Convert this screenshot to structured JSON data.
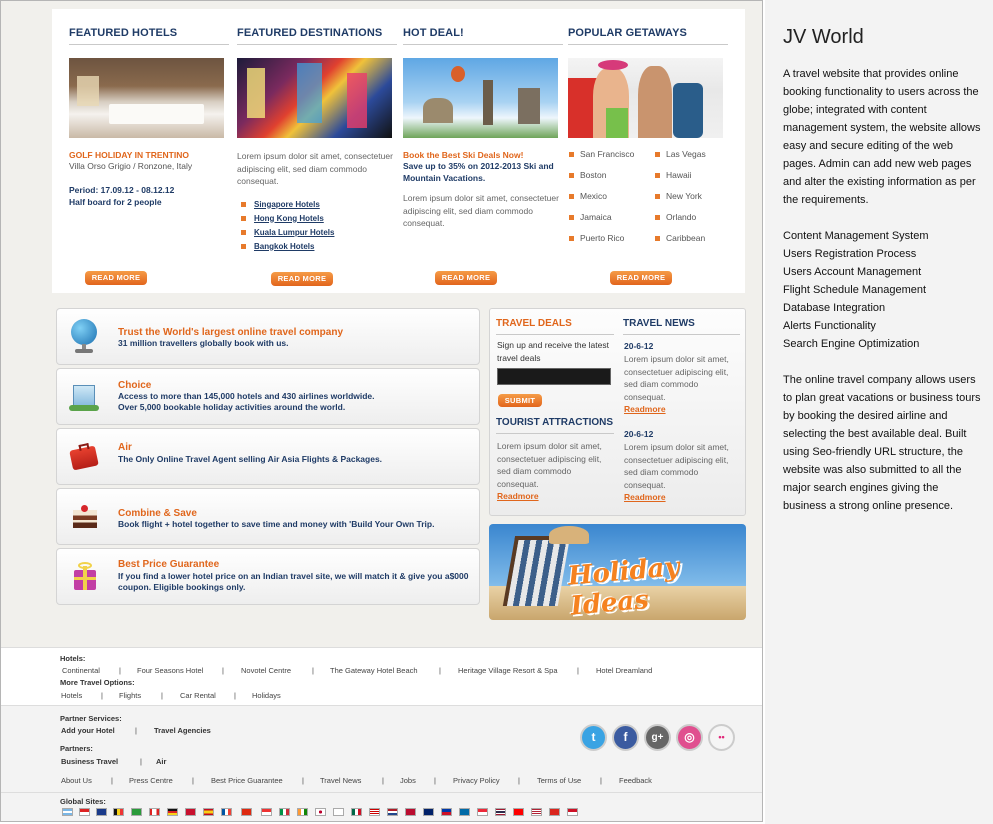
{
  "featured_hotels": {
    "heading": "FEATURED HOTELS",
    "tag": "GOLF HOLIDAY IN TRENTINO",
    "location": "Villa Orso Grigio / Ronzone, Italy",
    "period": "Period: 17.09.12 - 08.12.12",
    "board": "Half board for 2 people",
    "read_more": "READ MORE"
  },
  "featured_destinations": {
    "heading": "FEATURED DESTINATIONS",
    "text": "Lorem ipsum dolor sit amet, consectetuer adipiscing elit, sed diam commodo consequat.",
    "links": [
      "Singapore Hotels",
      "Hong Kong Hotels",
      "Kuala Lumpur Hotels",
      "Bangkok Hotels"
    ],
    "read_more": "READ MORE"
  },
  "hot_deal": {
    "heading": "HOT DEAL!",
    "tag": "Book the Best Ski Deals Now!",
    "offer": "Save up to 35% on 2012-2013 Ski and Mountain Vacations.",
    "text": "Lorem ipsum dolor sit amet, consectetuer adipiscing elit, sed diam commodo consequat.",
    "read_more": "READ MORE"
  },
  "popular_getaways": {
    "heading": "POPULAR GETAWAYS",
    "left": [
      "San Francisco",
      "Boston",
      "Mexico",
      "Jamaica",
      "Puerto Rico"
    ],
    "right": [
      "Las Vegas",
      "Hawaii",
      "New York",
      "Orlando",
      "Caribbean"
    ],
    "read_more": "READ MORE"
  },
  "features": [
    {
      "title": "Trust the World's largest online travel company",
      "desc": "31 million travellers globally book with us.",
      "icon": "globe-icon"
    },
    {
      "title": "Choice",
      "desc": "Access to more than 145,000 hotels and 430 airlines worldwide.\nOver 5,000 bookable holiday activities around the world.",
      "icon": "hotel-icon"
    },
    {
      "title": "Air",
      "desc": "The Only Online Travel Agent selling Air Asia Flights & Packages.",
      "icon": "suitcase-icon"
    },
    {
      "title": "Combine & Save",
      "desc": "Book flight + hotel together to save time and money with 'Build Your Own Trip.",
      "icon": "cake-icon"
    },
    {
      "title": "Best Price Guarantee",
      "desc": "If you find a lower hotel price on an Indian travel site, we will match it & give you a$000\ncoupon. Eligible bookings only.",
      "icon": "gift-icon"
    }
  ],
  "travel_deals": {
    "heading": "TRAVEL DEALS",
    "text": "Sign up and receive the latest travel deals",
    "submit": "SUBMIT"
  },
  "tourist": {
    "heading": "TOURIST ATTRACTIONS",
    "text": "Lorem ipsum dolor sit amet, consectetuer adipiscing elit, sed diam commodo consequat.",
    "link": "Readmore"
  },
  "travel_news": {
    "heading": "TRAVEL NEWS",
    "items": [
      {
        "date": "20-6-12",
        "text": "Lorem ipsum dolor sit amet, consectetuer adipiscing elit, sed diam commodo consequat.",
        "link": "Readmore"
      },
      {
        "date": "20-6-12",
        "text": "Lorem ipsum dolor sit amet, consectetuer adipiscing elit, sed diam commodo consequat.",
        "link": "Readmore"
      }
    ]
  },
  "holiday_banner": "Holiday Ideas",
  "footer": {
    "hotels_label": "Hotels:",
    "hotels": [
      "Continental",
      "Four Seasons Hotel",
      "Novotel  Centre",
      "The Gateway Hotel Beach",
      "Heritage Village Resort & Spa",
      "Hotel Dreamland"
    ],
    "more_label": "More Travel Options:",
    "more": [
      "Hotels",
      "Flights",
      "Car Rental",
      "Holidays"
    ],
    "partner_services_label": "Partner Services:",
    "partner_services": [
      "Add your Hotel",
      "Travel Agencies"
    ],
    "partners_label": "Partners:",
    "partners": [
      "Business Travel",
      "Air"
    ],
    "links": [
      "About Us",
      "Press Centre",
      "Best Price Guarantee",
      "Travel News",
      "Jobs",
      "Privacy Policy",
      "Terms of Use",
      "Feedback"
    ],
    "global_label": "Global Sites:",
    "social": [
      {
        "icon": "twitter-icon",
        "color": "#3aa3e3",
        "glyph": "t"
      },
      {
        "icon": "facebook-icon",
        "color": "#3b5ba0",
        "glyph": "f"
      },
      {
        "icon": "google-plus-icon",
        "color": "#666666",
        "glyph": "g+"
      },
      {
        "icon": "dribbble-icon",
        "color": "#e04f8f",
        "glyph": "◎"
      },
      {
        "icon": "flickr-icon",
        "color": "#f5f5f5",
        "glyph": "••"
      }
    ]
  },
  "side": {
    "title": "JV World",
    "p1": "A travel website that provides online booking functionality to users across the globe; integrated with content management system, the website allows easy and secure editing of the web pages. Admin can add new web pages and alter the existing information as per the requirements.",
    "features": [
      "Content Management System",
      "Users Registration Process",
      "Users Account Management",
      "Flight Schedule Management",
      "Database Integration",
      "Alerts Functionality",
      "Search Engine Optimization"
    ],
    "p2": "The online travel company allows users to plan great vacations or business tours by booking the desired airline and selecting the best available deal. Built using Seo-friendly URL structure, the website was also submitted to all the major search engines giving the business a strong online presence."
  }
}
